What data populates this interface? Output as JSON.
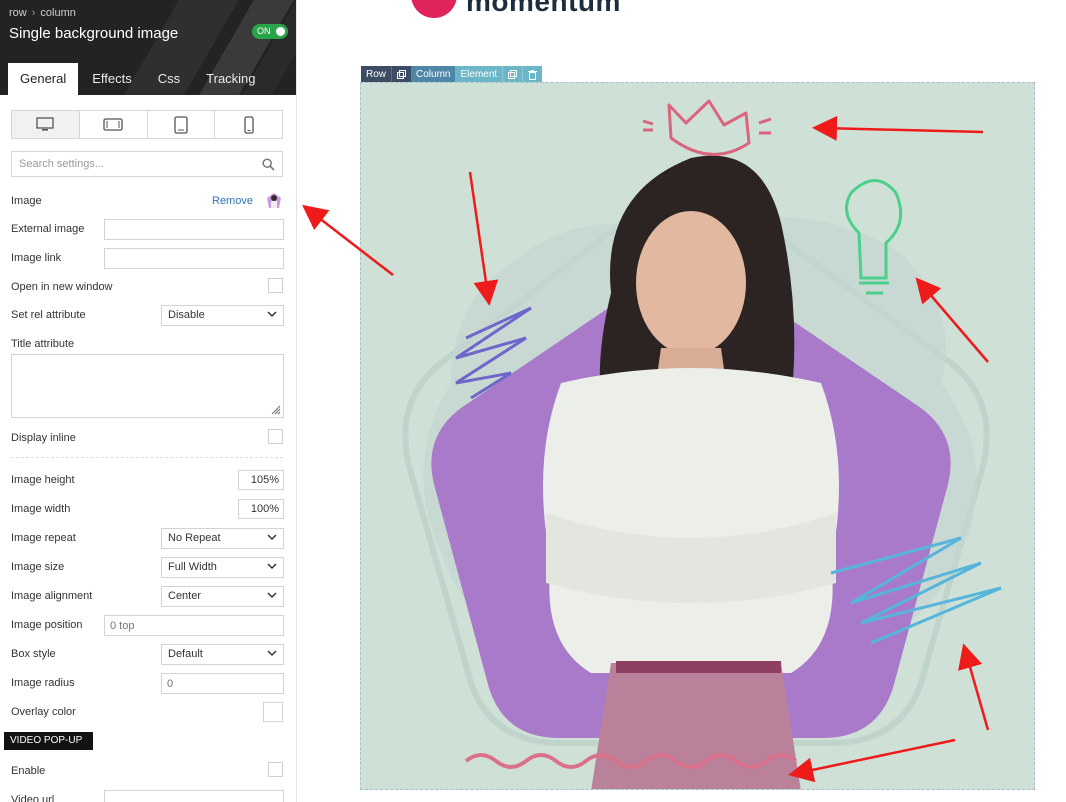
{
  "sidebar": {
    "breadcrumb": {
      "row": "row",
      "column": "column",
      "separator": "›"
    },
    "title": "Single background image",
    "toggle_label": "ON",
    "tabs": [
      {
        "label": "General",
        "active": true
      },
      {
        "label": "Effects",
        "active": false
      },
      {
        "label": "Css",
        "active": false
      },
      {
        "label": "Tracking",
        "active": false
      }
    ],
    "devices": [
      "desktop-icon",
      "tablet-landscape-icon",
      "tablet-portrait-icon",
      "mobile-icon"
    ],
    "search_placeholder": "Search settings...",
    "fields": {
      "image": {
        "label": "Image",
        "remove": "Remove"
      },
      "external_image": {
        "label": "External image",
        "value": ""
      },
      "image_link": {
        "label": "Image link",
        "value": ""
      },
      "open_new_window": {
        "label": "Open in new window",
        "checked": false
      },
      "rel": {
        "label": "Set rel attribute",
        "value": "Disable"
      },
      "title_attr": {
        "label": "Title attribute",
        "value": ""
      },
      "display_inline": {
        "label": "Display inline",
        "checked": false
      },
      "image_height": {
        "label": "Image height",
        "value": "105%"
      },
      "image_width": {
        "label": "Image width",
        "value": "100%"
      },
      "image_repeat": {
        "label": "Image repeat",
        "value": "No Repeat"
      },
      "image_size": {
        "label": "Image size",
        "value": "Full Width"
      },
      "image_alignment": {
        "label": "Image alignment",
        "value": "Center"
      },
      "image_position": {
        "label": "Image position",
        "placeholder": "0 top"
      },
      "box_style": {
        "label": "Box style",
        "value": "Default"
      },
      "image_radius": {
        "label": "Image radius",
        "placeholder": "0"
      },
      "overlay_color": {
        "label": "Overlay color"
      },
      "video_section": "VIDEO POP-UP",
      "enable": {
        "label": "Enable",
        "checked": false
      },
      "video_url": {
        "label": "Video url"
      }
    }
  },
  "canvas": {
    "brand_name": "momentum",
    "toolbar": {
      "row": "Row",
      "column": "Column",
      "element": "Element"
    },
    "colors": {
      "background": "#cfe1d6",
      "pentagon": "#a87ac9",
      "crown": "#d9667e",
      "bulb": "#4ccf8c",
      "zigzag": "#7065c9",
      "scribble": "#57b5dc",
      "wave": "#d87189",
      "arrows": "#ee1b1b"
    }
  }
}
